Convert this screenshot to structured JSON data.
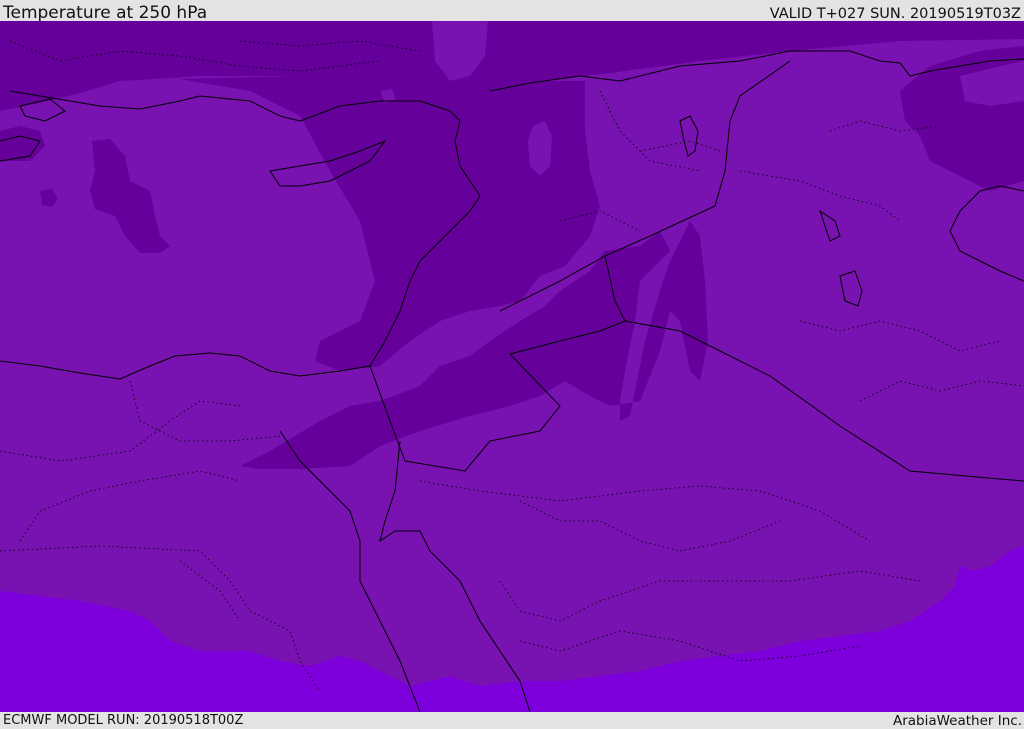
{
  "header": {
    "title": "Temperature at 250 hPa",
    "valid_time": "VALID T+027 SUN. 20190519T03Z"
  },
  "footer": {
    "model_run": "ECMWF MODEL RUN: 20190518T00Z",
    "credit": "ArabiaWeather Inc."
  },
  "map": {
    "variable": "temperature",
    "level": "250 hPa",
    "colors": {
      "coldest": "#65009b",
      "mid": "#7812b0",
      "warmest": "#7d00dc",
      "coastline": "#000000",
      "border_dotted": "#000000"
    }
  }
}
